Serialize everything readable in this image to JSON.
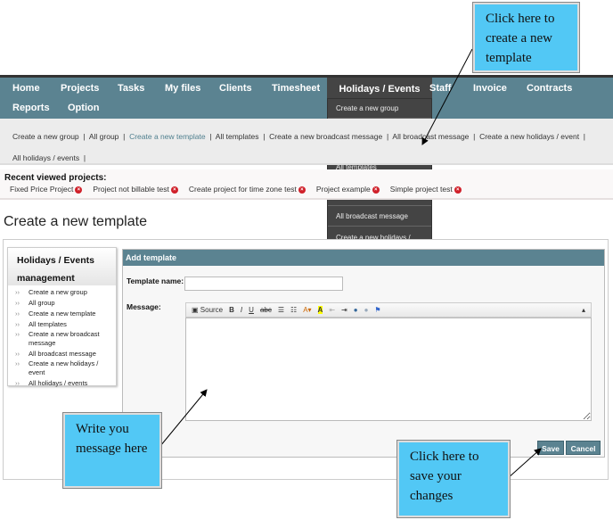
{
  "nav": {
    "items": [
      "Home",
      "Projects",
      "Tasks",
      "My files",
      "Clients",
      "Timesheet",
      "Holidays / Events",
      "Staff",
      "Invoice",
      "Contracts",
      "Reports",
      "Option"
    ],
    "active": "Holidays / Events"
  },
  "dropdown": {
    "items": [
      "Create a new group",
      "All group",
      "Create a new template",
      "All templates",
      "Create a new broadcast message",
      "All broadcast message",
      "Create a new holidays / event",
      "All holidays / events"
    ],
    "selected": "Create a new template"
  },
  "subnav": {
    "items": [
      "Create a new group",
      "All group",
      "Create a new template",
      "All templates",
      "Create a new broadcast message",
      "All broadcast message",
      "Create a new holidays / event",
      "All holidays / events"
    ],
    "current": "Create a new template"
  },
  "recent": {
    "title": "Recent viewed projects:",
    "items": [
      "Fixed Price Project",
      "Project not billable test",
      "Create project for time zone test",
      "Project example",
      "Simple project test"
    ]
  },
  "page_title": "Create a new template",
  "sidebar": {
    "title": "Holidays / Events management",
    "items": [
      "Create a new group",
      "All group",
      "Create a new template",
      "All templates",
      "Create a new broadcast message",
      "All broadcast message",
      "Create a new holidays / event",
      "All holidays / events"
    ]
  },
  "panel": {
    "title": "Add template",
    "template_name_label": "Template name:",
    "template_name_value": "",
    "message_label": "Message:",
    "toolbar": {
      "source": "Source"
    }
  },
  "buttons": {
    "save": "Save",
    "cancel": "Cancel"
  },
  "callouts": {
    "top": "Click here to create a new template",
    "left": "Write you message here",
    "right": "Click here to save your changes"
  },
  "colors": {
    "nav": "#5b8391",
    "callout": "#52c8f5"
  }
}
